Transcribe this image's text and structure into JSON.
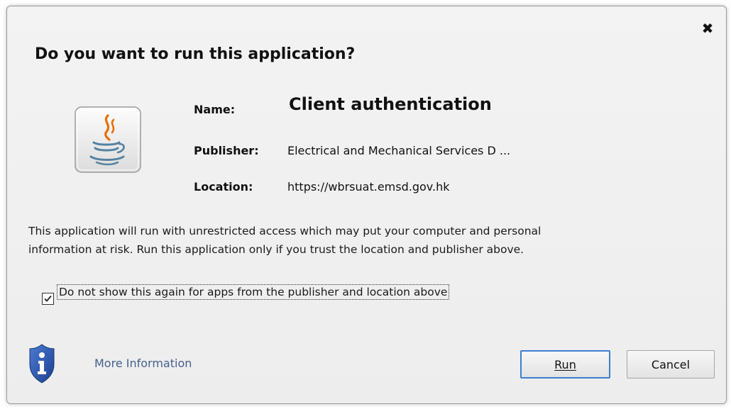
{
  "dialog": {
    "title": "Do you want to run this application?",
    "close_symbol": "✖"
  },
  "app": {
    "icon": "java-icon",
    "name_label": "Name:",
    "name_value": "Client authentication",
    "publisher_label": "Publisher:",
    "publisher_value": "Electrical and Mechanical Services D ...",
    "location_label": "Location:",
    "location_value": "https://wbrsuat.emsd.gov.hk"
  },
  "warning": {
    "line1": "This application will run with unrestricted access which may put your computer and personal",
    "line2": "information at risk. Run this application only if you trust the location and publisher above."
  },
  "checkbox": {
    "label": "Do not show this again for apps from the publisher and location above",
    "checked": true
  },
  "footer": {
    "shield_icon": "info-shield-icon",
    "more_info": "More Information",
    "run_label": "Run",
    "cancel_label": "Cancel"
  },
  "colors": {
    "link": "#45608c",
    "default_button_border": "#3c7fd0",
    "shield_blue": "#2b55a8"
  }
}
